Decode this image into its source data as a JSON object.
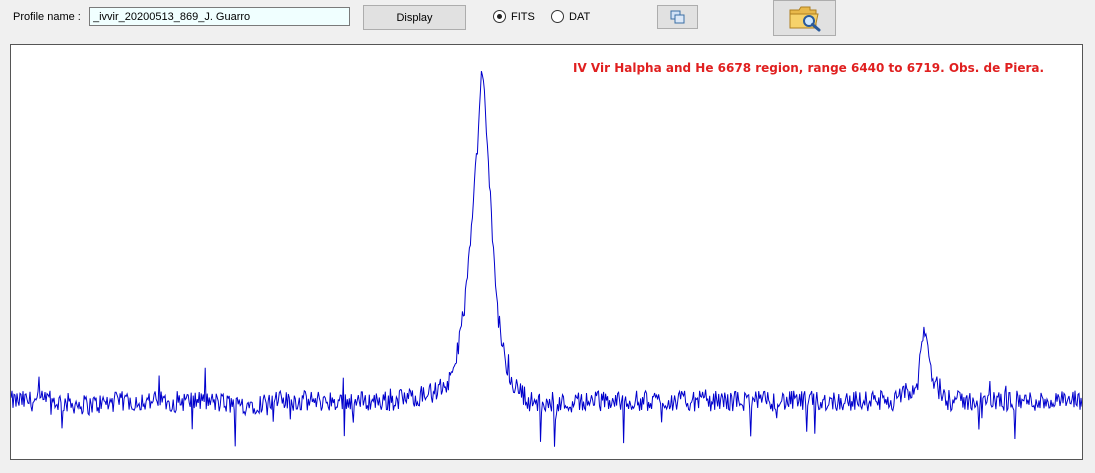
{
  "toolbar": {
    "profile_label": "Profile name :",
    "profile_value": "_ivvir_20200513_869_J. Guarro",
    "display_label": "Display",
    "format_options": [
      {
        "label": "FITS",
        "selected": true
      },
      {
        "label": "DAT",
        "selected": false
      }
    ]
  },
  "icons": {
    "copy": "copy-icon",
    "folder": "folder-search-icon"
  },
  "colors": {
    "spectrum_line": "#0000cc",
    "title_text": "#e02020"
  },
  "chart_data": {
    "type": "line",
    "title": "IV Vir Halpha and He 6678 region, range 6440 to 6719. Obs. de Piera.",
    "xlabel": "",
    "ylabel": "",
    "xlim": [
      6440,
      6719
    ],
    "ylim": [
      0,
      1
    ],
    "grid": false,
    "series": [
      {
        "x": [
          6440,
          6450,
          6460,
          6470,
          6480,
          6490,
          6500,
          6510,
          6520,
          6530,
          6540,
          6550,
          6555,
          6558,
          6560,
          6562,
          6562.8,
          6564,
          6566,
          6568,
          6570,
          6575,
          6580,
          6590,
          6600,
          6620,
          6640,
          6660,
          6670,
          6676,
          6678,
          6680,
          6684,
          6690,
          6700,
          6710,
          6719
        ],
        "y": [
          0.14,
          0.14,
          0.13,
          0.14,
          0.14,
          0.14,
          0.13,
          0.14,
          0.14,
          0.14,
          0.14,
          0.16,
          0.19,
          0.36,
          0.55,
          0.83,
          0.95,
          0.77,
          0.45,
          0.27,
          0.19,
          0.14,
          0.13,
          0.14,
          0.14,
          0.14,
          0.14,
          0.14,
          0.14,
          0.17,
          0.32,
          0.19,
          0.14,
          0.14,
          0.14,
          0.14,
          0.14
        ]
      }
    ]
  }
}
